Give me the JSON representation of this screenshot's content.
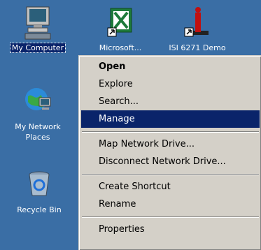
{
  "desktop": {
    "icons": [
      {
        "label": "My Computer",
        "icon": "computer-icon"
      },
      {
        "label": "Microsoft...",
        "icon": "excel-icon"
      },
      {
        "label": "ISI 6271 Demo",
        "icon": "demo-shortcut-icon"
      },
      {
        "label": "My Network Places",
        "label_line1": "My Network",
        "label_line2": "Places",
        "icon": "network-places-icon"
      },
      {
        "label": "Recycle Bin",
        "icon": "recycle-bin-icon"
      }
    ]
  },
  "context_menu": {
    "items": [
      {
        "label": "Open",
        "bold": true
      },
      {
        "label": "Explore"
      },
      {
        "label": "Search..."
      },
      {
        "label": "Manage",
        "highlighted": true
      },
      {
        "label": "Map Network Drive..."
      },
      {
        "label": "Disconnect Network Drive..."
      },
      {
        "label": "Create Shortcut"
      },
      {
        "label": "Rename"
      },
      {
        "label": "Properties"
      }
    ]
  },
  "colors": {
    "desktop_bg": "#3a6ea5",
    "menu_bg": "#d4d0c8",
    "highlight": "#0a246a"
  }
}
